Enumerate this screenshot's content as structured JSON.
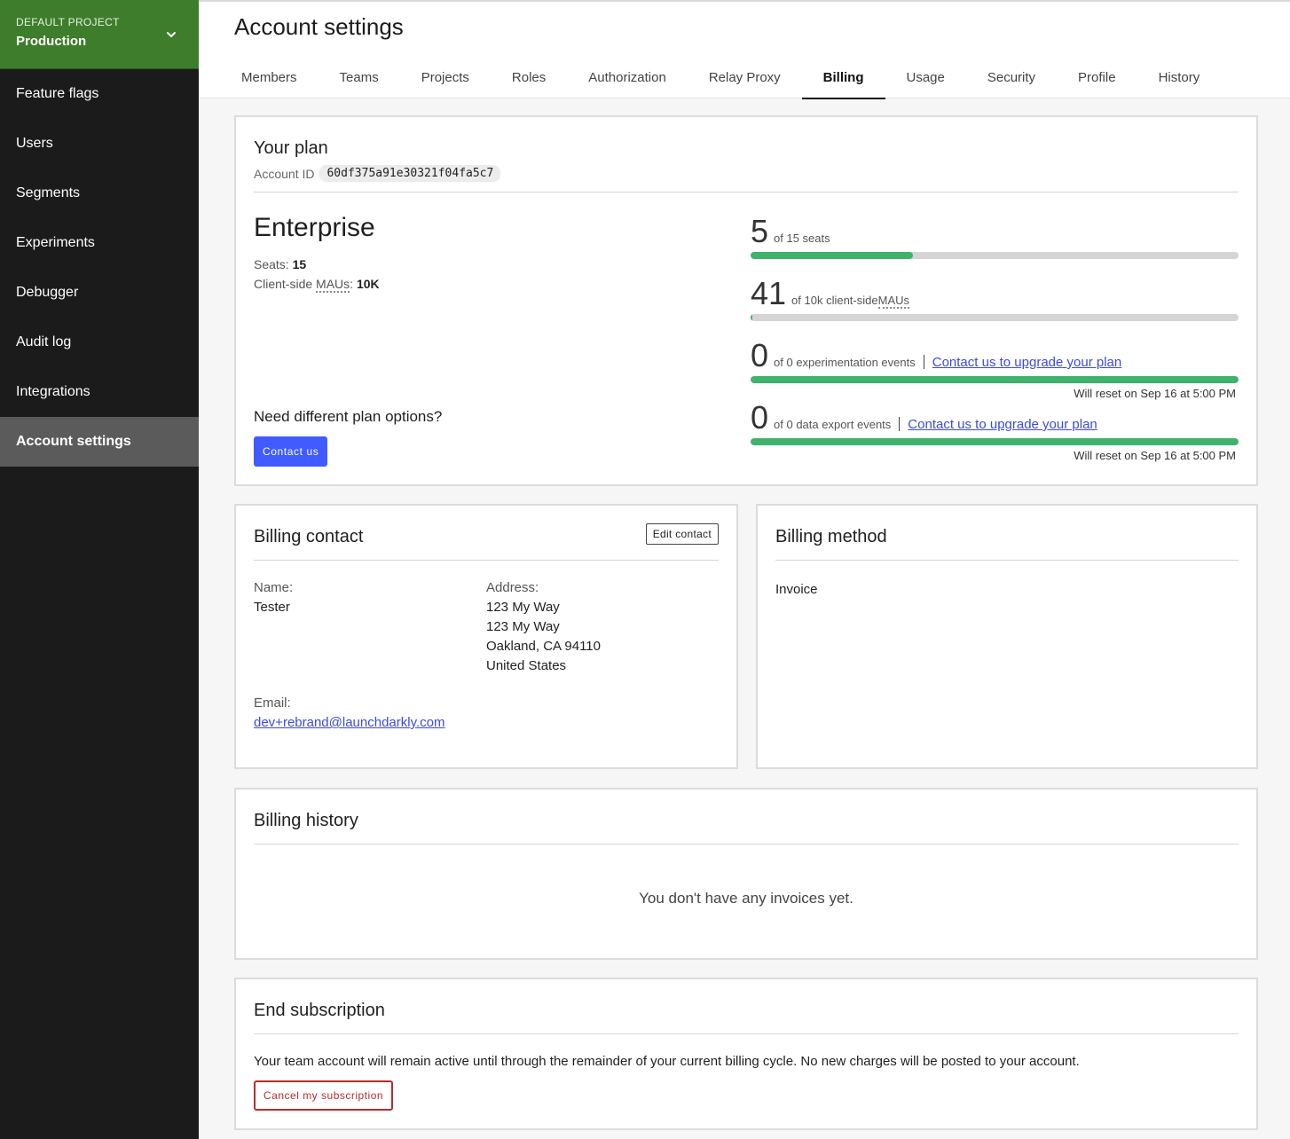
{
  "sidebar": {
    "project_label": "DEFAULT PROJECT",
    "project_name": "Production",
    "items": [
      {
        "label": "Feature flags"
      },
      {
        "label": "Users"
      },
      {
        "label": "Segments"
      },
      {
        "label": "Experiments"
      },
      {
        "label": "Debugger"
      },
      {
        "label": "Audit log"
      },
      {
        "label": "Integrations"
      },
      {
        "label": "Account settings",
        "active": true
      }
    ]
  },
  "header": {
    "title": "Account settings",
    "tabs": [
      {
        "label": "Members"
      },
      {
        "label": "Teams"
      },
      {
        "label": "Projects"
      },
      {
        "label": "Roles"
      },
      {
        "label": "Authorization"
      },
      {
        "label": "Relay Proxy"
      },
      {
        "label": "Billing",
        "active": true
      },
      {
        "label": "Usage"
      },
      {
        "label": "Security"
      },
      {
        "label": "Profile"
      },
      {
        "label": "History"
      }
    ]
  },
  "plan": {
    "title": "Your plan",
    "account_id_label": "Account ID",
    "account_id": "60df375a91e30321f04fa5c7",
    "name": "Enterprise",
    "seats_label": "Seats:",
    "seats_value": "15",
    "mau_label_prefix": "Client-side ",
    "mau_label_abbr": "MAUs",
    "mau_label_suffix": ":",
    "mau_value": "10K",
    "need_options": "Need different plan options?",
    "contact_button": "Contact us",
    "usage": [
      {
        "count": "5",
        "text": "of 15 seats",
        "fill": 0.333
      },
      {
        "count": "41",
        "text_prefix": "of 10k client-side ",
        "text_abbr": "MAUs",
        "fill": 0.004
      },
      {
        "count": "0",
        "text": "of 0 experimentation events",
        "link": "Contact us to upgrade your plan",
        "fill": 1.0,
        "reset": "Will reset on Sep 16 at 5:00 PM"
      },
      {
        "count": "0",
        "text": "of 0 data export events",
        "link": "Contact us to upgrade your plan",
        "fill": 1.0,
        "reset": "Will reset on Sep 16 at 5:00 PM"
      }
    ]
  },
  "billing_contact": {
    "title": "Billing contact",
    "edit_button": "Edit contact",
    "name_label": "Name:",
    "name_value": "Tester",
    "address_label": "Address:",
    "address_lines": [
      "123 My Way",
      "123 My Way",
      "Oakland, CA 94110",
      "United States"
    ],
    "email_label": "Email:",
    "email_value": "dev+rebrand@launchdarkly.com"
  },
  "billing_method": {
    "title": "Billing method",
    "value": "Invoice"
  },
  "billing_history": {
    "title": "Billing history",
    "empty_text": "You don't have any invoices yet."
  },
  "end_subscription": {
    "title": "End subscription",
    "text": "Your team account will remain active until through the remainder of your current billing cycle. No new charges will be posted to your account.",
    "cancel_button": "Cancel my subscription"
  },
  "colors": {
    "sidebar_bg": "#1b1b1b",
    "project_bg": "#3e7d2b",
    "accent_button": "#405bff",
    "progress_fill": "#3fb26b",
    "danger": "#b42d2d",
    "link": "#3c4ad9"
  }
}
